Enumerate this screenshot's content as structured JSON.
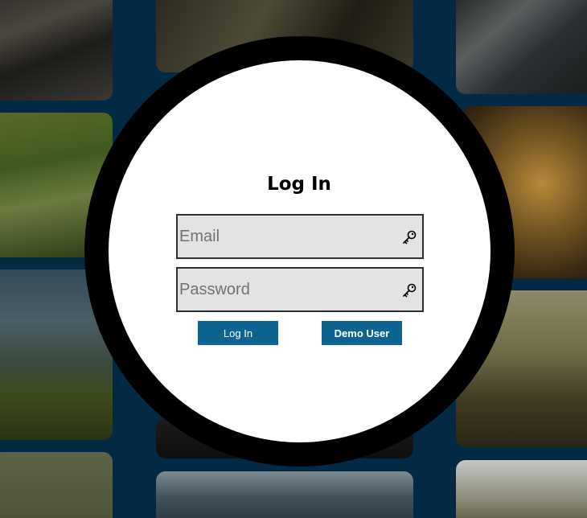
{
  "login": {
    "title": "Log In",
    "email": {
      "placeholder": "Email",
      "value": "",
      "icon": "key-icon"
    },
    "password": {
      "placeholder": "Password",
      "value": "",
      "icon": "key-icon"
    },
    "login_button": "Log In",
    "demo_button": "Demo User"
  },
  "colors": {
    "background": "#032a45",
    "button": "#0d6491",
    "ring": "#000000",
    "field_bg": "#e3e3e3"
  }
}
